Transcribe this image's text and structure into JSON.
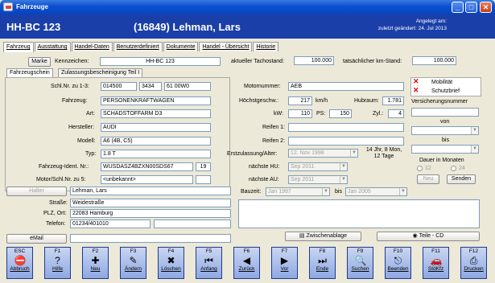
{
  "window": {
    "title": "Fahrzeuge",
    "min": "_",
    "max": "□",
    "close": "✕"
  },
  "header": {
    "plate": "HH-BC 123",
    "customer": "(16849) Lehman, Lars",
    "created_label": "Angelegt am:",
    "changed_label": "zuletzt geändert: 24. Jul 2013"
  },
  "tabs": [
    "Fahrzeug",
    "Ausstattung",
    "Handel-Daten",
    "Benutzerdefiniert",
    "Dokumente",
    "Handel - Übersicht",
    "Historie"
  ],
  "top": {
    "marke_btn": "Marke",
    "kennzeichen_label": "Kennzeichen:",
    "kennzeichen": "HH-BC 123",
    "tacho_label": "aktueller Tachostand:",
    "tacho": "100.000",
    "km_label": "tatsächlicher km-Stand:",
    "km": "100.000"
  },
  "subtabs": [
    "Fahrzeugschein",
    "Zulassungsbescheinigung Teil I"
  ],
  "left": {
    "schl_label": "Schl.Nr. zu 1-3:",
    "schl1": "014500",
    "schl2": "3434",
    "schl3": "61 00W0",
    "fahrzeug_label": "Fahrzeug:",
    "fahrzeug": "PERSONENKRAFTWAGEN",
    "art_label": "Art:",
    "art": "SCHADSTOFFARM D3",
    "hersteller_label": "Hersteller:",
    "hersteller": "AUDI",
    "modell_label": "Modell:",
    "modell": "A6 (4B, C5)",
    "typ_label": "Typ:",
    "typ": "1.8 T",
    "fin_label": "Fahrzeug-Ident. Nr.:",
    "fin": "WUSDASZ4BZXN00SDS67",
    "fin2": "19",
    "motor_label": "Motor/Schl.Nr. zu 5:",
    "motor": "<unbekannt>"
  },
  "middle": {
    "motornummer_label": "Motornummer:",
    "motornummer": "AEB",
    "hoechst_label": "Höchstgeschw.:",
    "hoechst": "217",
    "hoechst_unit": "km/h",
    "hubraum_label": "Hubraum:",
    "hubraum": "1.781",
    "kw_label": "kW:",
    "kw": "110",
    "ps_label": "PS:",
    "ps": "150",
    "zyl_label": "Zyl.:",
    "zyl": "4",
    "reifen1_label": "Reifen 1:",
    "reifen2_label": "Reifen 2:",
    "erstzul_label": "Erstzulassung/Alter:",
    "erstzul": "12. Nov 1998",
    "alter": "14 Jhr, 8 Mon, 12 Tage",
    "hu_label": "nächste HU:",
    "hu": "Sep 2011",
    "au_label": "nächste AU:",
    "au": "Sep 2011"
  },
  "right": {
    "mobilitaet": "Mobilität",
    "schutzbrief": "Schutzbrief",
    "versicherung_label": "Versicherungsnummer",
    "von_label": "von",
    "bis_label": "bis",
    "dauer_label": "Dauer in Monaten",
    "r12": "12",
    "r24": "24",
    "neu_btn": "Neu",
    "senden_btn": "Senden"
  },
  "halter": {
    "halter_btn": "Halter",
    "halter": "Lehman, Lars",
    "strasse_label": "Straße:",
    "strasse": "Weidestraße",
    "plz_label": "PLZ, Ort:",
    "plz": "22083 Hamburg",
    "tel_label": "Telefon:",
    "tel": "01234/401010",
    "email_btn": "eMail"
  },
  "bauzeit": {
    "label": "Bauzeit:",
    "von": "Jan 1997",
    "bis_label": "bis",
    "bis": "Jan 2005"
  },
  "buttons": {
    "zwischenablage": "Zwischenablage",
    "teile": "Teile - CD"
  },
  "fkeys": [
    {
      "key": "ESC",
      "label": "Abbruch",
      "icon": "stop-icon",
      "glyph": "⛔"
    },
    {
      "key": "F1",
      "label": "Hilfe",
      "icon": "help-icon",
      "glyph": "?"
    },
    {
      "key": "F2",
      "label": "Neu",
      "icon": "new-icon",
      "glyph": "✚"
    },
    {
      "key": "F3",
      "label": "Ändern",
      "icon": "edit-icon",
      "glyph": "✎"
    },
    {
      "key": "F4",
      "label": "Löschen",
      "icon": "delete-icon",
      "glyph": "✖"
    },
    {
      "key": "F5",
      "label": "Anfang",
      "icon": "first-icon",
      "glyph": "⏮"
    },
    {
      "key": "F6",
      "label": "Zurück",
      "icon": "back-icon",
      "glyph": "◀"
    },
    {
      "key": "F7",
      "label": "Vor",
      "icon": "forward-icon",
      "glyph": "▶"
    },
    {
      "key": "F8",
      "label": "Ende",
      "icon": "last-icon",
      "glyph": "⏭"
    },
    {
      "key": "F9",
      "label": "Suchen",
      "icon": "search-icon",
      "glyph": "🔍"
    },
    {
      "key": "F10",
      "label": "Beenden",
      "icon": "exit-icon",
      "glyph": "⎋"
    },
    {
      "key": "F11",
      "label": "StdKfz",
      "icon": "car-icon",
      "glyph": "🚗"
    },
    {
      "key": "F12",
      "label": "Drucken",
      "icon": "printer-icon",
      "glyph": "⎙"
    }
  ]
}
